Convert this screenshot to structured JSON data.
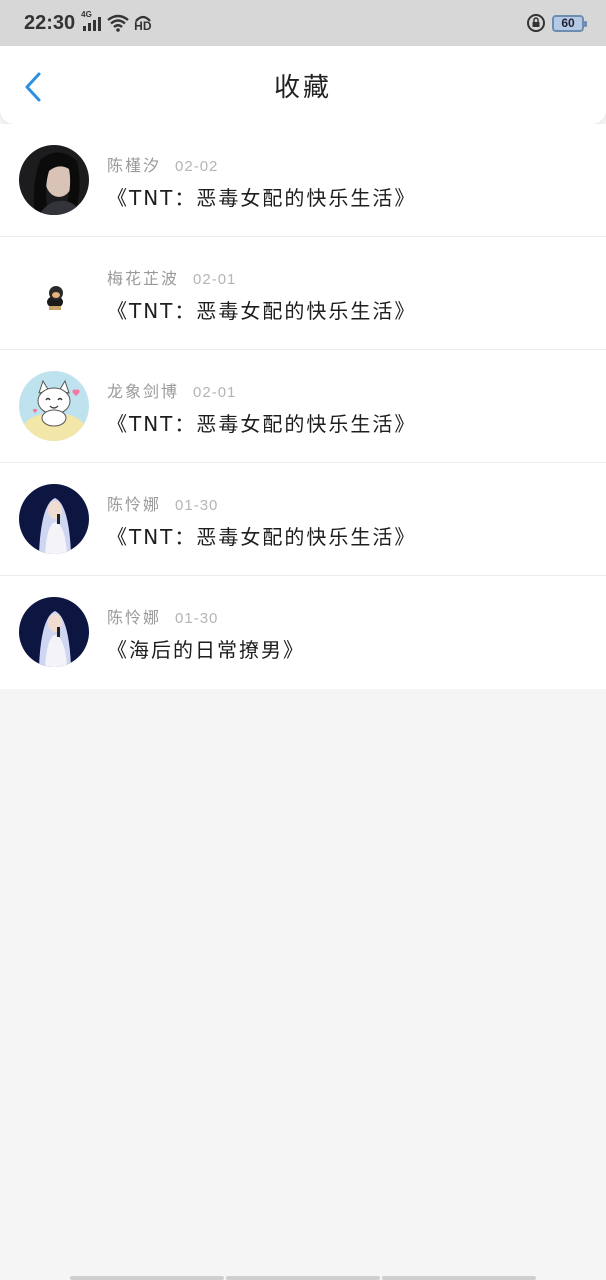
{
  "status_bar": {
    "time": "22:30",
    "network": "4G",
    "hd_label": "HD",
    "battery": "60"
  },
  "header": {
    "title": "收藏",
    "back_icon": "chevron-left-icon",
    "accent_color": "#2e8fe0"
  },
  "favorites": [
    {
      "author": "陈槿汐",
      "date": "02-02",
      "book": "《TNT：恶毒女配的快乐生活》",
      "avatar": "woman-portrait-dark"
    },
    {
      "author": "梅花芷波",
      "date": "02-01",
      "book": "《TNT：恶毒女配的快乐生活》",
      "avatar": "small-monkey-figure"
    },
    {
      "author": "龙象剑博",
      "date": "02-01",
      "book": "《TNT：恶毒女配的快乐生活》",
      "avatar": "cartoon-cat"
    },
    {
      "author": "陈怜娜",
      "date": "01-30",
      "book": "《TNT：恶毒女配的快乐生活》",
      "avatar": "singer-on-stage"
    },
    {
      "author": "陈怜娜",
      "date": "01-30",
      "book": "《海后的日常撩男》",
      "avatar": "singer-on-stage"
    }
  ]
}
